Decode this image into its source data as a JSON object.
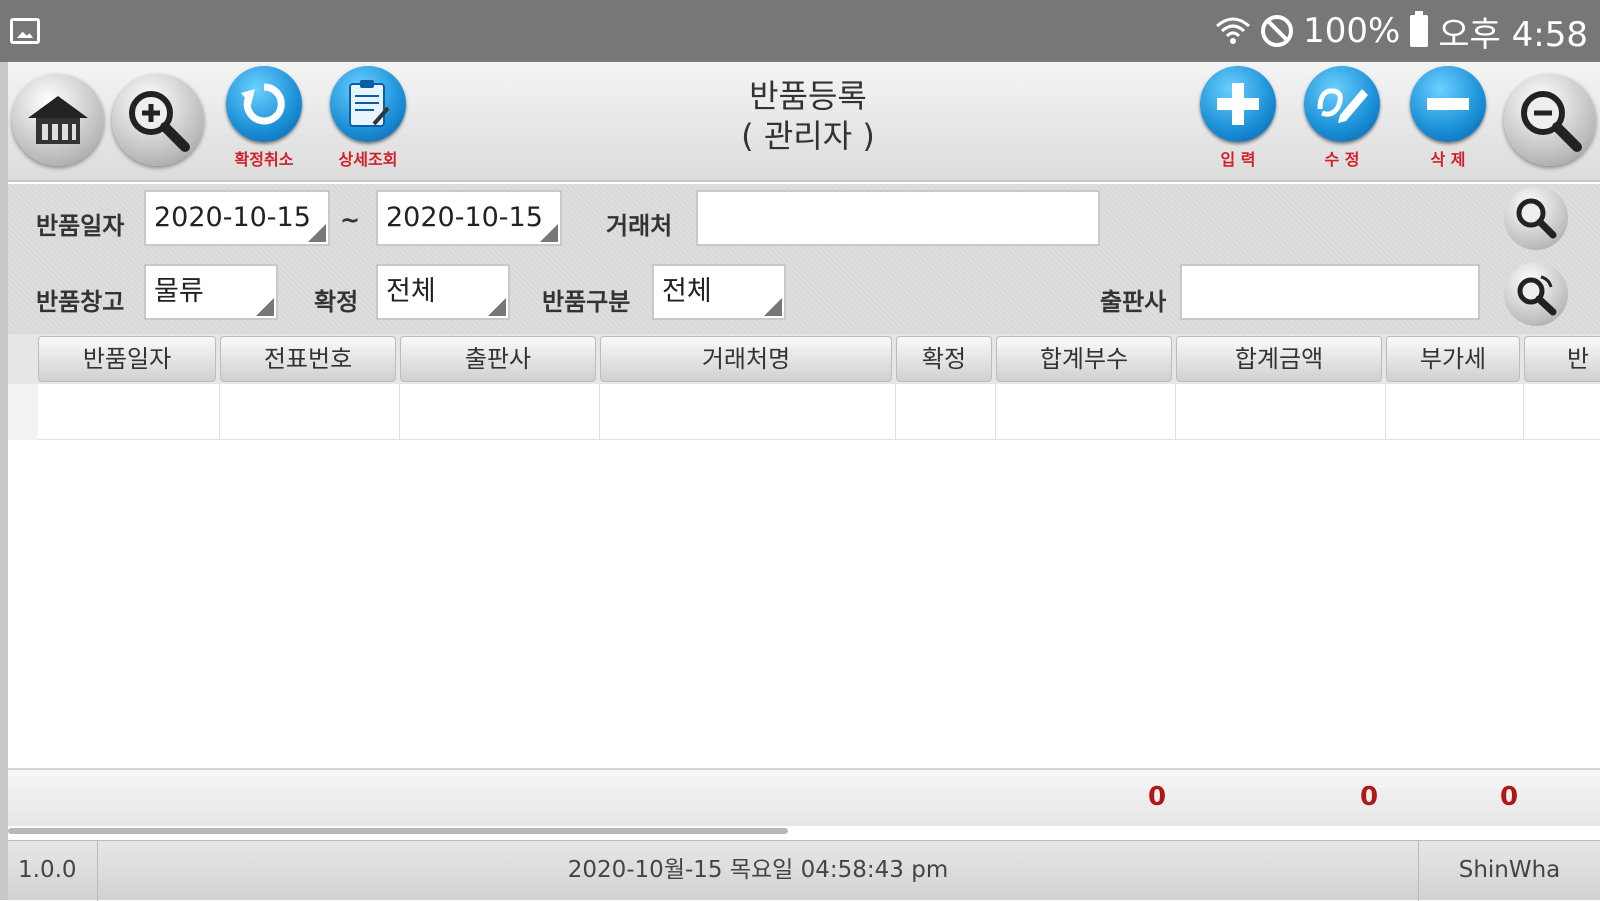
{
  "statusbar": {
    "battery": "100%",
    "time": "오후 4:58"
  },
  "toolbar": {
    "title_line1": "반품등록",
    "title_line2": "( 관리자 )",
    "buttons": {
      "confirm_cancel": "확정취소",
      "detail_view": "상세조회",
      "input": "입 력",
      "edit": "수 정",
      "delete": "삭 제"
    }
  },
  "filters": {
    "return_date_label": "반품일자",
    "date_from": "2020-10-15",
    "date_sep": "~",
    "date_to": "2020-10-15",
    "client_label": "거래처",
    "client_value": "",
    "warehouse_label": "반품창고",
    "warehouse_value": "물류",
    "confirm_label": "확정",
    "confirm_value": "전체",
    "return_type_label": "반품구분",
    "return_type_value": "전체",
    "publisher_label": "출판사",
    "publisher_value": ""
  },
  "table": {
    "columns": [
      "반품일자",
      "전표번호",
      "출판사",
      "거래처명",
      "확정",
      "합계부수",
      "합계금액",
      "부가세",
      "반"
    ]
  },
  "totals": {
    "total_qty": "0",
    "total_amount": "0",
    "vat": "0"
  },
  "footer": {
    "version": "1.0.0",
    "datetime": "2020-10월-15 목요일 04:58:43 pm",
    "company": "ShinWha"
  }
}
